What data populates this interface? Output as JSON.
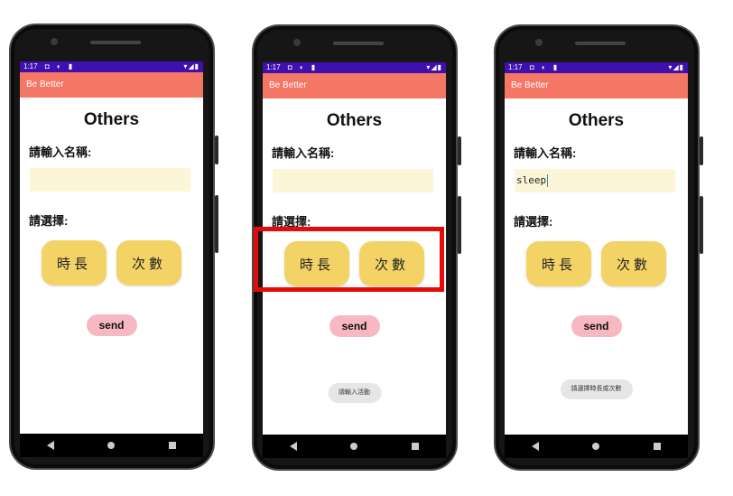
{
  "phones": [
    {
      "status_time": "1:17",
      "app_title": "Be Better",
      "page_title": "Others",
      "name_label": "請輸入名稱:",
      "name_value": "",
      "choose_label": "請選擇:",
      "option_duration": "時長",
      "option_count": "次數",
      "send_label": "send",
      "toast": ""
    },
    {
      "status_time": "1:17",
      "app_title": "Be Better",
      "page_title": "Others",
      "name_label": "請輸入名稱:",
      "name_value": "",
      "choose_label": "請選擇:",
      "option_duration": "時長",
      "option_count": "次數",
      "send_label": "send",
      "toast": "請輸入活動"
    },
    {
      "status_time": "1:17",
      "app_title": "Be Better",
      "page_title": "Others",
      "name_label": "請輸入名稱:",
      "name_value": "sleep",
      "choose_label": "請選擇:",
      "option_duration": "時長",
      "option_count": "次數",
      "send_label": "send",
      "toast": "請選擇時長或次數"
    }
  ],
  "colors": {
    "status_bar": "#3f0fb0",
    "app_bar": "#f47665",
    "option_button": "#f4d366",
    "send_button": "#f7b8c2",
    "input_bg": "#fdf5d8",
    "highlight": "#e40b0b"
  }
}
